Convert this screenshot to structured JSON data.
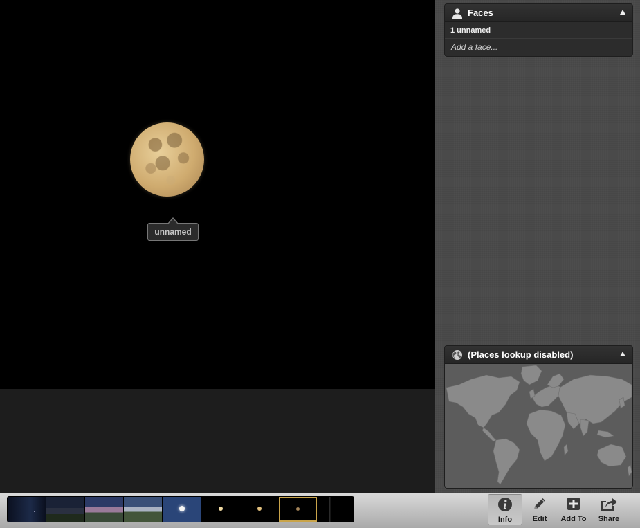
{
  "viewer": {
    "face_label": "unnamed"
  },
  "sidebar": {
    "faces": {
      "title": "Faces",
      "count_text": "1 unnamed",
      "add_placeholder": "Add a face..."
    },
    "places": {
      "title": "(Places lookup disabled)"
    }
  },
  "toolbar": {
    "info_label": "Info",
    "edit_label": "Edit",
    "addto_label": "Add To",
    "share_label": "Share"
  },
  "filmstrip": {
    "thumbnail_count": 9,
    "selected_index": 7
  },
  "colors": {
    "selection_accent": "#c9a44a",
    "photo_background": "#000000"
  },
  "icons": [
    "person-icon",
    "globe-icon",
    "collapse-triangle-icon",
    "info-icon",
    "pencil-icon",
    "add-icon",
    "share-icon"
  ]
}
